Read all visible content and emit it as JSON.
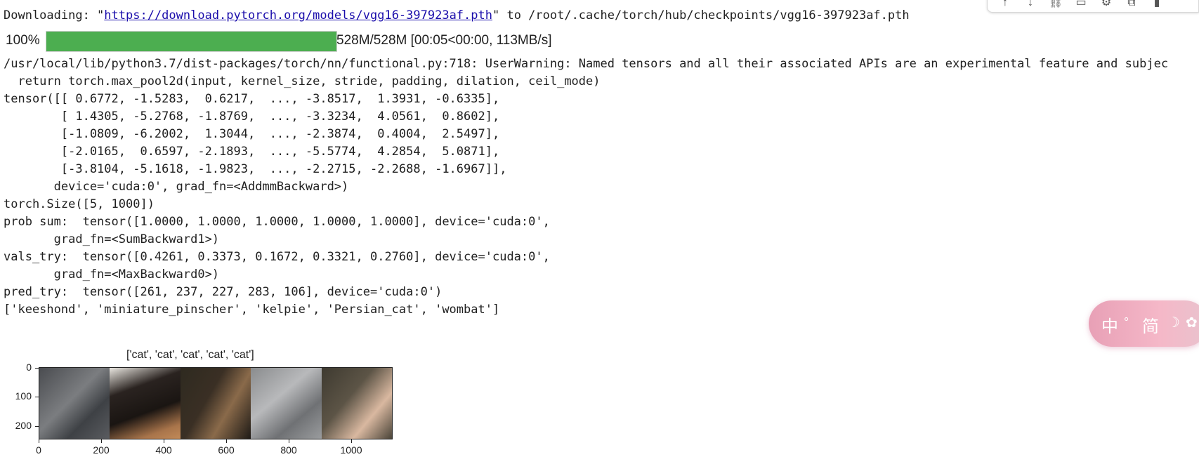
{
  "download": {
    "prefix": "Downloading: \"",
    "url": "https://download.pytorch.org/models/vgg16-397923af.pth",
    "suffix": "\" to /root/.cache/torch/hub/checkpoints/vgg16-397923af.pth"
  },
  "progress": {
    "percent_label": "100%",
    "fraction": 1.0,
    "stats": "528M/528M [00:05<00:00, 113MB/s]"
  },
  "warning_lines": [
    "/usr/local/lib/python3.7/dist-packages/torch/nn/functional.py:718: UserWarning: Named tensors and all their associated APIs are an experimental feature and subjec",
    "  return torch.max_pool2d(input, kernel_size, stride, padding, dilation, ceil_mode)"
  ],
  "output_lines": [
    "tensor([[ 0.6772, -1.5283,  0.6217,  ..., -3.8517,  1.3931, -0.6335],",
    "        [ 1.4305, -5.2768, -1.8769,  ..., -3.3234,  4.0561,  0.8602],",
    "        [-1.0809, -6.2002,  1.3044,  ..., -2.3874,  0.4004,  2.5497],",
    "        [-2.0165,  0.6597, -2.1893,  ..., -5.5774,  4.2854,  5.0871],",
    "        [-3.8104, -5.1618, -1.9823,  ..., -2.2715, -2.2688, -1.6967]],",
    "       device='cuda:0', grad_fn=<AddmmBackward>)",
    "torch.Size([5, 1000])",
    "prob sum:  tensor([1.0000, 1.0000, 1.0000, 1.0000, 1.0000], device='cuda:0',",
    "       grad_fn=<SumBackward1>)",
    "vals_try:  tensor([0.4261, 0.3373, 0.1672, 0.3321, 0.2760], device='cuda:0',",
    "       grad_fn=<MaxBackward0>)",
    "pred_try:  tensor([261, 237, 227, 283, 106], device='cuda:0')",
    "['keeshond', 'miniature_pinscher', 'kelpie', 'Persian_cat', 'wombat']"
  ],
  "plot": {
    "title": "['cat', 'cat', 'cat', 'cat', 'cat']",
    "y_ticks": [
      "0",
      "100",
      "200"
    ],
    "x_ticks": [
      "0",
      "200",
      "400",
      "600",
      "800",
      "1000"
    ]
  },
  "toolbar": {
    "icons": [
      "arrow-up-icon",
      "arrow-down-icon",
      "link-icon",
      "comment-icon",
      "gear-icon",
      "copy-icon",
      "trash-icon"
    ]
  },
  "widget": {
    "chars": [
      "中",
      "°",
      "简",
      "☽",
      "✿"
    ]
  }
}
